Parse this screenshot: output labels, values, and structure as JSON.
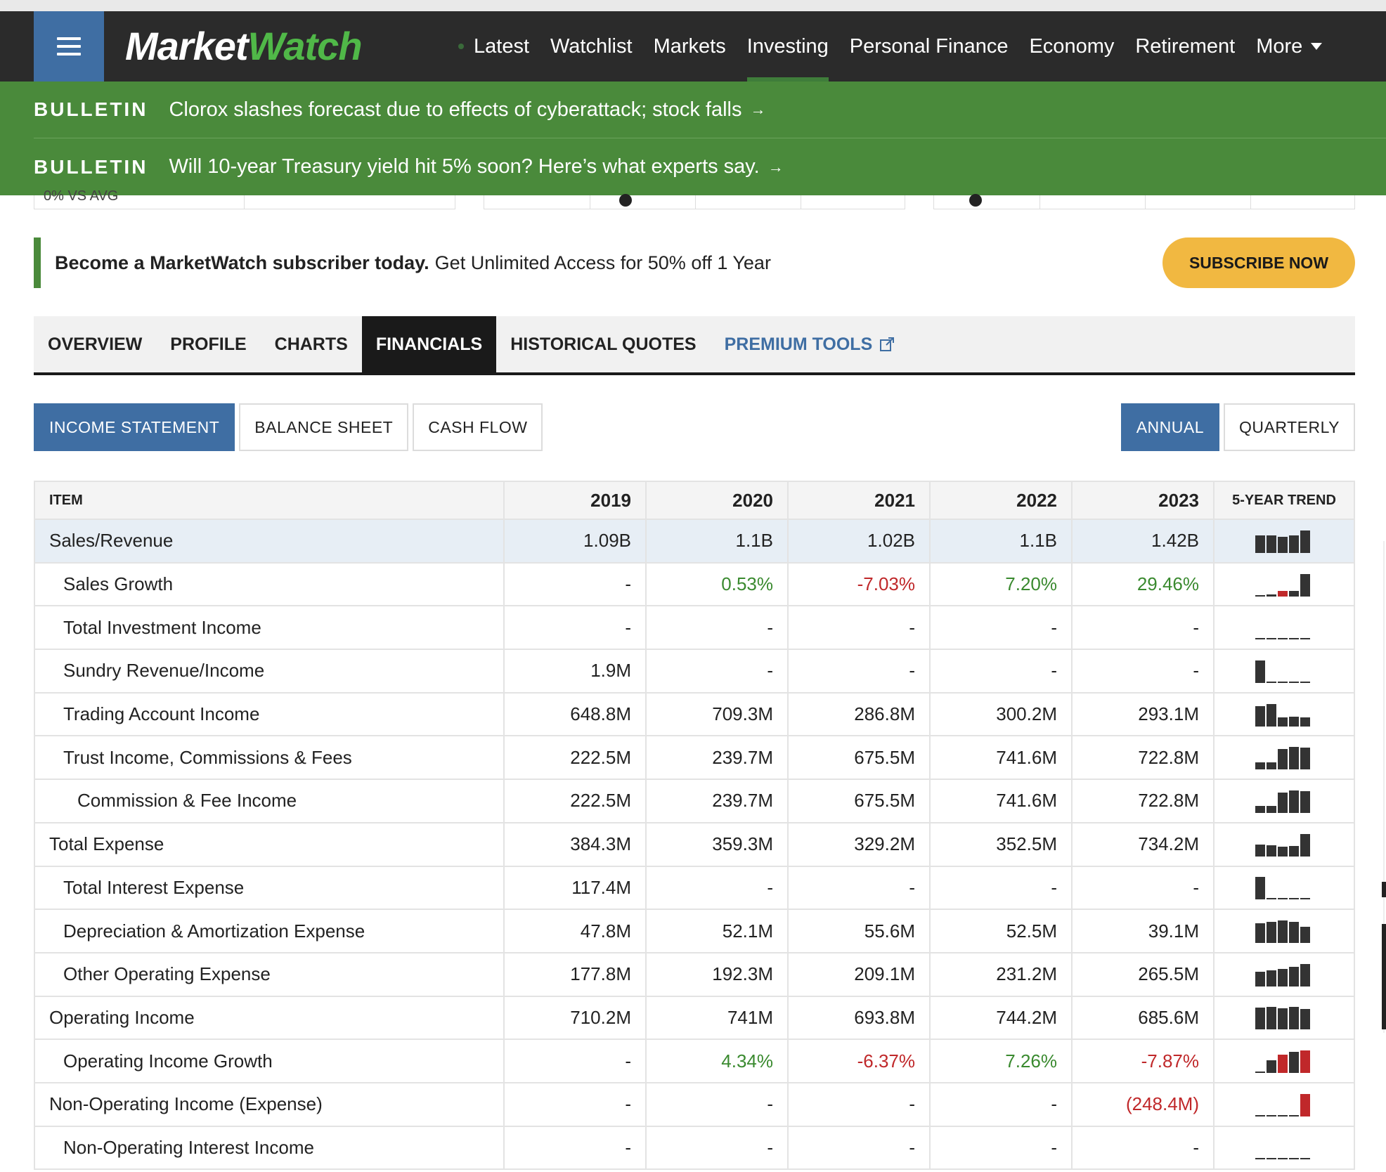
{
  "header": {
    "logo_part1": "Market",
    "logo_part2": "Watch",
    "nav": [
      "Latest",
      "Watchlist",
      "Markets",
      "Investing",
      "Personal Finance",
      "Economy",
      "Retirement"
    ],
    "nav_more": "More",
    "active_nav": "Investing"
  },
  "bulletins": [
    {
      "tag": "BULLETIN",
      "text": "Clorox slashes forecast due to effects of cyberattack; stock falls",
      "arrow": "→"
    },
    {
      "tag": "BULLETIN",
      "text": "Will 10-year Treasury yield hit 5% soon? Here’s what experts say.",
      "arrow": "→"
    }
  ],
  "partial": {
    "label": "0% VS AVG"
  },
  "subscribe": {
    "bold": "Become a MarketWatch subscriber today.",
    "text": "Get Unlimited Access for 50% off 1 Year",
    "button": "SUBSCRIBE NOW"
  },
  "tabs": [
    "OVERVIEW",
    "PROFILE",
    "CHARTS",
    "FINANCIALS",
    "HISTORICAL QUOTES",
    "PREMIUM TOOLS"
  ],
  "active_tab": "FINANCIALS",
  "statements": [
    "INCOME STATEMENT",
    "BALANCE SHEET",
    "CASH FLOW"
  ],
  "periods": [
    "ANNUAL",
    "QUARTERLY"
  ],
  "table": {
    "headers": [
      "ITEM",
      "2019",
      "2020",
      "2021",
      "2022",
      "2023",
      "5-YEAR TREND"
    ],
    "rows": [
      {
        "item": "Sales/Revenue",
        "level": 0,
        "values": [
          "1.09B",
          "1.1B",
          "1.02B",
          "1.1B",
          "1.42B"
        ]
      },
      {
        "item": "Sales Growth",
        "level": 1,
        "values": [
          "-",
          "0.53%",
          "-7.03%",
          "7.20%",
          "29.46%"
        ]
      },
      {
        "item": "Total Investment Income",
        "level": 1,
        "values": [
          "-",
          "-",
          "-",
          "-",
          "-"
        ]
      },
      {
        "item": "Sundry Revenue/Income",
        "level": 1,
        "values": [
          "1.9M",
          "-",
          "-",
          "-",
          "-"
        ]
      },
      {
        "item": "Trading Account Income",
        "level": 1,
        "values": [
          "648.8M",
          "709.3M",
          "286.8M",
          "300.2M",
          "293.1M"
        ]
      },
      {
        "item": "Trust Income, Commissions & Fees",
        "level": 1,
        "values": [
          "222.5M",
          "239.7M",
          "675.5M",
          "741.6M",
          "722.8M"
        ]
      },
      {
        "item": "Commission & Fee Income",
        "level": 2,
        "values": [
          "222.5M",
          "239.7M",
          "675.5M",
          "741.6M",
          "722.8M"
        ]
      },
      {
        "item": "Total Expense",
        "level": 0,
        "values": [
          "384.3M",
          "359.3M",
          "329.2M",
          "352.5M",
          "734.2M"
        ]
      },
      {
        "item": "Total Interest Expense",
        "level": 1,
        "values": [
          "117.4M",
          "-",
          "-",
          "-",
          "-"
        ]
      },
      {
        "item": "Depreciation & Amortization Expense",
        "level": 1,
        "values": [
          "47.8M",
          "52.1M",
          "55.6M",
          "52.5M",
          "39.1M"
        ]
      },
      {
        "item": "Other Operating Expense",
        "level": 1,
        "values": [
          "177.8M",
          "192.3M",
          "209.1M",
          "231.2M",
          "265.5M"
        ]
      },
      {
        "item": "Operating Income",
        "level": 0,
        "values": [
          "710.2M",
          "741M",
          "693.8M",
          "744.2M",
          "685.6M"
        ]
      },
      {
        "item": "Operating Income Growth",
        "level": 1,
        "values": [
          "-",
          "4.34%",
          "-6.37%",
          "7.26%",
          "-7.87%"
        ]
      },
      {
        "item": "Non-Operating Income (Expense)",
        "level": 0,
        "values": [
          "-",
          "-",
          "-",
          "-",
          "(248.4M)"
        ]
      },
      {
        "item": "Non-Operating Interest Income",
        "level": 1,
        "values": [
          "-",
          "-",
          "-",
          "-",
          "-"
        ]
      }
    ]
  },
  "colors": {
    "header_bg": "#2b2b2b",
    "menu_blue": "#3f6ea3",
    "bulletin_green": "#4a8a3b",
    "subscribe_yellow": "#f1b841",
    "positive": "#3a8a2f",
    "negative": "#c0282a"
  }
}
